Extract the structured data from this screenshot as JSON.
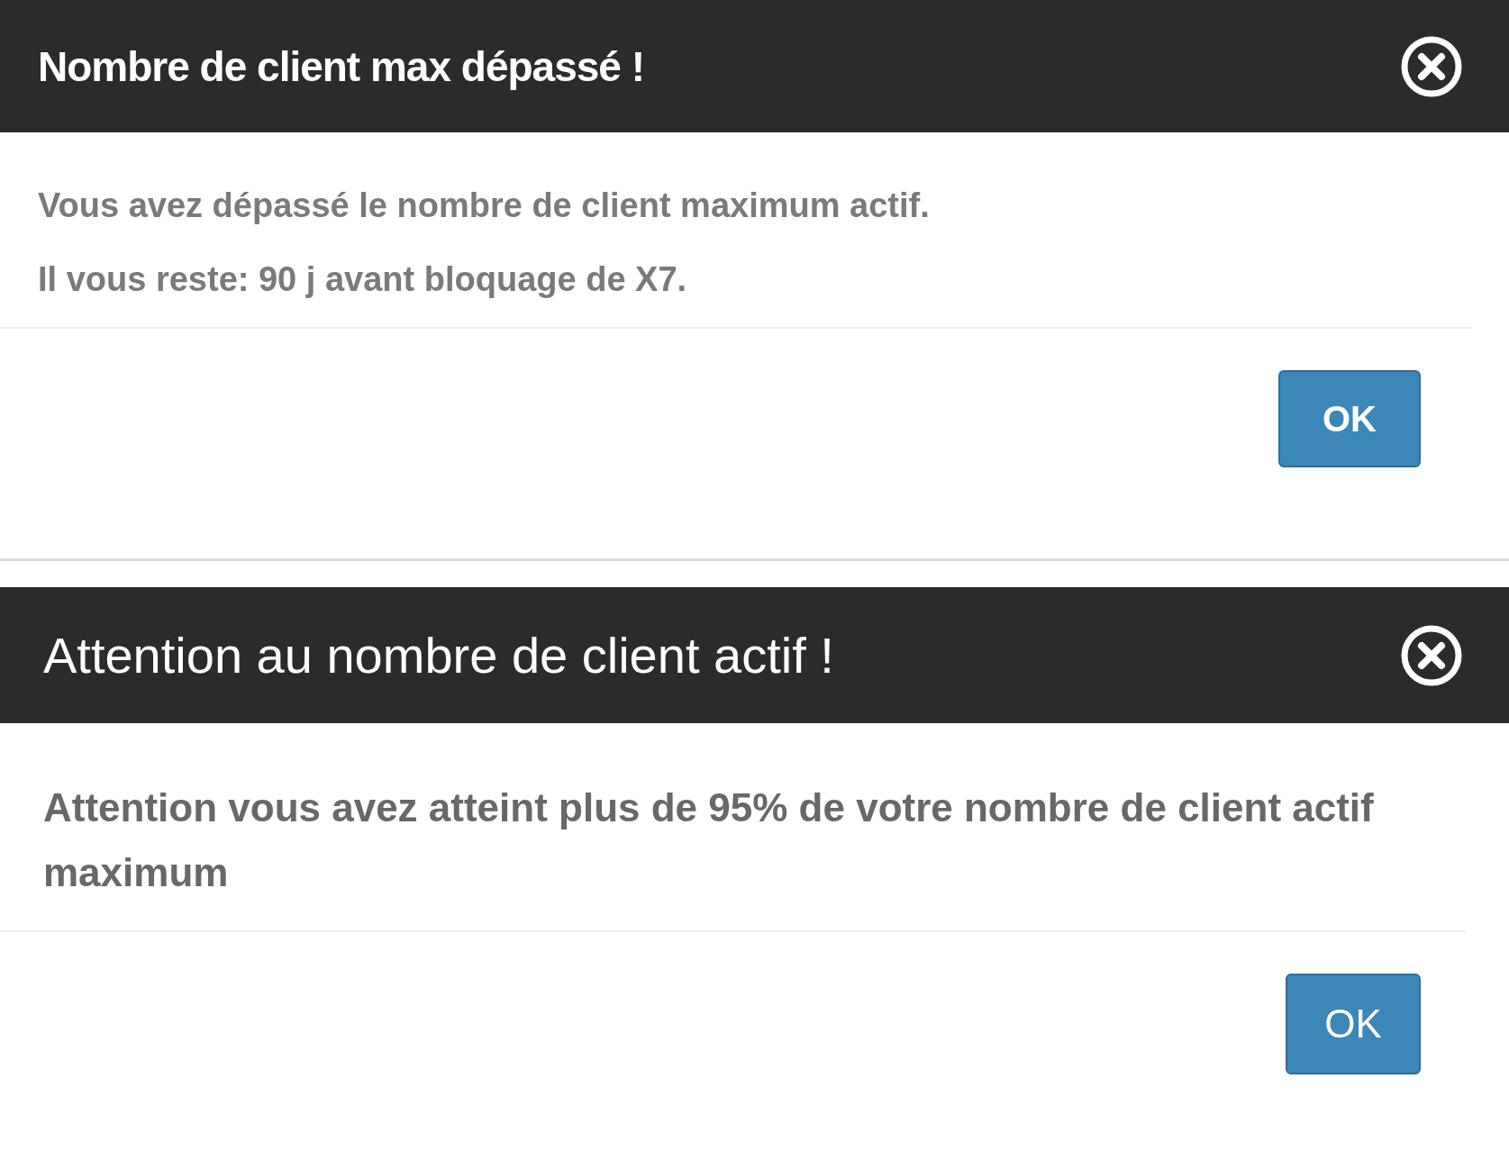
{
  "dialogs": [
    {
      "kind": "compact",
      "title": "Nombre de client max dépassé !",
      "lines": [
        "Vous avez dépassé le nombre de client maximum actif.",
        "Il vous reste: 90 j avant bloquage de X7."
      ],
      "button": "OK"
    },
    {
      "kind": "regular",
      "title": "Attention au nombre de client actif !",
      "lines": [
        "Attention vous avez atteint plus de 95% de votre nombre de client actif maximum"
      ],
      "button": "OK"
    }
  ]
}
